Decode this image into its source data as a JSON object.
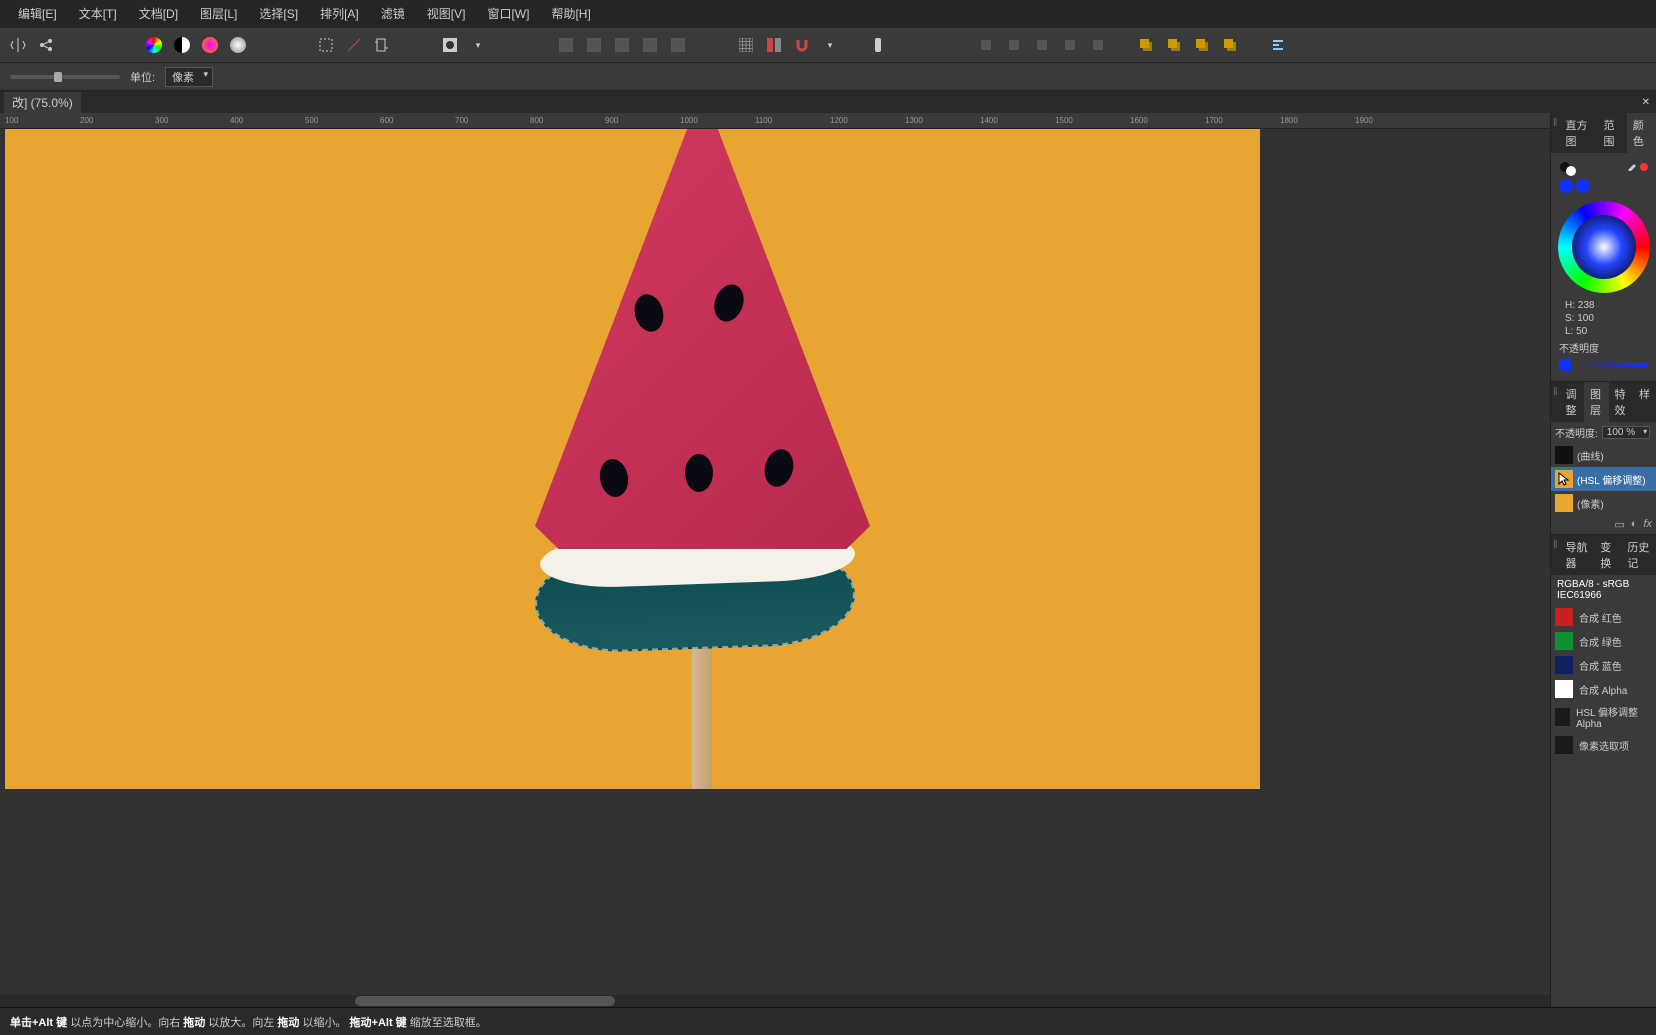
{
  "menu": [
    "编辑[E]",
    "文本[T]",
    "文档[D]",
    "图层[L]",
    "选择[S]",
    "排列[A]",
    "滤镜",
    "视图[V]",
    "窗口[W]",
    "帮助[H]"
  ],
  "opts": {
    "unit_label": "单位:",
    "unit_value": "像素"
  },
  "doc": {
    "title": "改] (75.0%)"
  },
  "ruler_ticks": [
    100,
    200,
    300,
    400,
    500,
    600,
    700,
    800,
    900,
    1000,
    1100,
    1200,
    1300,
    1400,
    1500,
    1600,
    1700,
    1800,
    1900
  ],
  "color_tabs": [
    "直方图",
    "范围",
    "颜色"
  ],
  "hsl": {
    "h": "H: 238",
    "s": "S: 100",
    "l": "L: 50"
  },
  "opacity_label": "不透明度",
  "adj_tabs": [
    "调整",
    "图层",
    "特效",
    "样"
  ],
  "layer_opacity_label": "不透明度:",
  "layer_opacity_value": "100 %",
  "layers": [
    {
      "name": "(曲线)",
      "thumb": "#111"
    },
    {
      "name": "(HSL 偏移调整)",
      "thumb": "#e8a532",
      "sel": true,
      "cursor": true
    },
    {
      "name": "(像素)",
      "thumb": "#e8a532"
    }
  ],
  "nav_tabs": [
    "导航器",
    "变换",
    "历史记"
  ],
  "channels_head": "RGBA/8 - sRGB IEC61966",
  "channels": [
    {
      "name": "合成 红色",
      "c": "#cc2020"
    },
    {
      "name": "合成 绿色",
      "c": "#109030"
    },
    {
      "name": "合成 蓝色",
      "c": "#102060"
    },
    {
      "name": "合成 Alpha",
      "c": "#ffffff"
    },
    {
      "name": "HSL 偏移调整 Alpha",
      "c": "#1a1a1a"
    },
    {
      "name": "像素选取项",
      "c": "#1a1a1a"
    }
  ],
  "status": {
    "p1a": "单击+Alt 键",
    "p1b": " 以点为中心缩小。向右 ",
    "p2a": "拖动",
    "p2b": " 以放大。向左 ",
    "p3a": "拖动",
    "p3b": " 以缩小。",
    "p4a": "拖动+Alt 键",
    "p4b": " 缩放至选取框。"
  }
}
